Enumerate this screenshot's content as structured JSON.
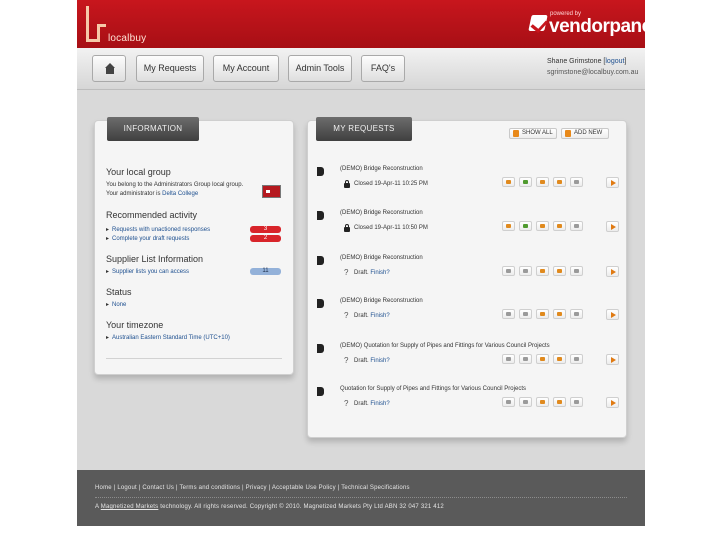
{
  "brand": {
    "logo_text": "localbuy",
    "partner_powered_by": "powered by",
    "partner_name": "vendorpanel"
  },
  "nav": {
    "items": [
      {
        "label": "My Requests"
      },
      {
        "label": "My Account"
      },
      {
        "label": "Admin Tools"
      },
      {
        "label": "FAQ's"
      }
    ]
  },
  "user": {
    "name": "Shane Grimstone",
    "logout": "logout",
    "email": "sgrimstone@localbuy.com.au"
  },
  "info_panel": {
    "tab": "INFORMATION",
    "local_group": {
      "title": "Your local group",
      "line1": "You belong to the Administrators Group local group.",
      "line2_prefix": "Your administrator is ",
      "line2_link": "Delta College"
    },
    "recommended": {
      "title": "Recommended activity",
      "items": [
        {
          "label": "Requests with unactioned responses",
          "count": "3"
        },
        {
          "label": "Complete your draft requests",
          "count": "2"
        }
      ]
    },
    "supplier": {
      "title": "Supplier List Information",
      "items": [
        {
          "label": "Supplier lists you can access",
          "count": "11"
        }
      ]
    },
    "status": {
      "title": "Status",
      "items": [
        {
          "label": "None"
        }
      ]
    },
    "timezone": {
      "title": "Your timezone",
      "items": [
        {
          "label": "Australian Eastern Standard Time (UTC+10)"
        }
      ]
    }
  },
  "requests_panel": {
    "tab": "MY REQUESTS",
    "show_all": "SHOW ALL",
    "add_new": "ADD NEW",
    "items": [
      {
        "title": "(DEMO) Bridge Reconstruction",
        "status": "Closed 19-Apr-11 10:25 PM",
        "status_link": "",
        "kind": "closed"
      },
      {
        "title": "(DEMO) Bridge Reconstruction",
        "status": "Closed 19-Apr-11 10:50 PM",
        "status_link": "",
        "kind": "closed"
      },
      {
        "title": "(DEMO) Bridge Reconstruction",
        "status": "Draft. ",
        "status_link": "Finish?",
        "kind": "draft"
      },
      {
        "title": "(DEMO) Bridge Reconstruction",
        "status": "Draft. ",
        "status_link": "Finish?",
        "kind": "draft"
      },
      {
        "title": "(DEMO) Quotation for Supply of Pipes and Fittings for Various Council Projects",
        "status": "Draft. ",
        "status_link": "Finish?",
        "kind": "draft"
      },
      {
        "title": "Quotation for Supply of Pipes and Fittings for Various Council Projects",
        "status": "Draft. ",
        "status_link": "Finish?",
        "kind": "draft"
      }
    ]
  },
  "footer": {
    "links": [
      "Home",
      "Logout",
      "Contact Us",
      "Terms and conditions",
      "Privacy",
      "Acceptable Use Policy",
      "Technical Specifications"
    ],
    "copy_prefix": "A ",
    "copy_link": "Magnetized Markets",
    "copy_suffix": " technology.  All rights reserved.  Copyright © 2010. Magnetized Markets Pty Ltd ABN 32 047 321 412"
  },
  "colors": {
    "brand_red": "#c8161d",
    "badge_red": "#d8242a",
    "badge_blue": "#93b1d9",
    "footer_gray": "#5a5a5a"
  }
}
